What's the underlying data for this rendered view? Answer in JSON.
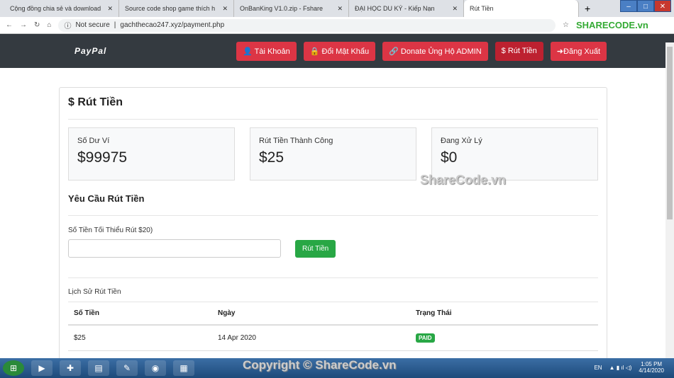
{
  "browser": {
    "tabs": [
      {
        "title": "Cộng đồng chia sẻ và download"
      },
      {
        "title": "Source code shop game thích h"
      },
      {
        "title": "OnBanKing V1.0.zip - Fshare"
      },
      {
        "title": "ĐẠI HỌC DU KÝ - Kiếp Nạn"
      },
      {
        "title": "Rút Tiền"
      }
    ],
    "security": "Not secure",
    "url": "gachthecao247.xyz/payment.php"
  },
  "nav": {
    "logo": "PayPal",
    "buttons": [
      {
        "label": "👤 Tài Khoản"
      },
      {
        "label": "🔒 Đổi Mật Khẩu"
      },
      {
        "label": "🔗 Donate Ủng Hộ ADMIN"
      },
      {
        "label": "$ Rút Tiền"
      },
      {
        "label": "➜Đăng Xuất"
      }
    ]
  },
  "page": {
    "title": "$ Rút Tiền",
    "stats": [
      {
        "label": "Số Dư Ví",
        "value": "$99975"
      },
      {
        "label": "Rút Tiền Thành Công",
        "value": "$25"
      },
      {
        "label": "Đang Xử Lý",
        "value": "$0"
      }
    ],
    "request_title": "Yêu Cầu Rút Tiền",
    "amount_label": "Số Tiền Tối Thiểu Rút $20)",
    "amount_value": "",
    "submit": "Rút Tiền",
    "history_title": "Lịch Sử Rút Tiền",
    "columns": [
      "Số Tiền",
      "Ngày",
      "Trạng Thái"
    ],
    "rows": [
      {
        "amount": "$25",
        "date": "14 Apr 2020",
        "status": "PAID"
      }
    ]
  },
  "watermarks": {
    "logo": "SHARECODE.vn",
    "center": "ShareCode.vn",
    "copyright": "Copyright © ShareCode.vn"
  },
  "taskbar": {
    "lang": "EN",
    "time": "1:05 PM",
    "date": "4/14/2020"
  }
}
